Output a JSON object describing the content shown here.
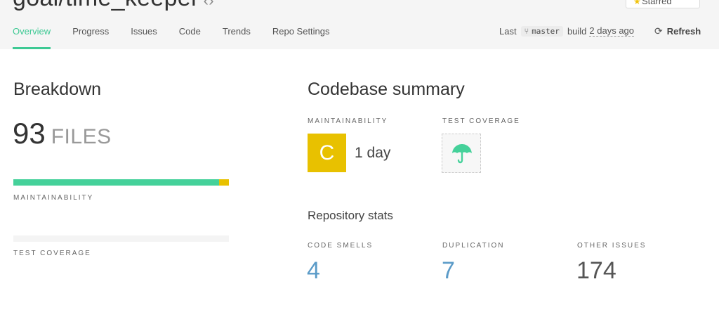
{
  "header": {
    "repo_title": "goal/time_keeper",
    "star_label": "Starred",
    "tabs": [
      {
        "label": "Overview",
        "active": true
      },
      {
        "label": "Progress"
      },
      {
        "label": "Issues"
      },
      {
        "label": "Code"
      },
      {
        "label": "Trends"
      },
      {
        "label": "Repo Settings"
      }
    ],
    "build": {
      "prefix": "Last",
      "branch": "master",
      "middle": "build",
      "ago": "2 days ago"
    },
    "refresh_label": "Refresh"
  },
  "breakdown": {
    "title": "Breakdown",
    "file_count": "93",
    "file_unit": "FILES",
    "maintainability_label": "MAINTAINABILITY",
    "maintainability_distribution": [
      {
        "grade": "A",
        "fraction": 0.955,
        "color": "#45d19a"
      },
      {
        "grade": "C",
        "fraction": 0.045,
        "color": "#e8c100"
      }
    ],
    "test_coverage_label": "TEST COVERAGE",
    "test_coverage_distribution": []
  },
  "summary": {
    "title": "Codebase summary",
    "maintainability_label": "MAINTAINABILITY",
    "maintainability_grade": "C",
    "maintainability_grade_color": "#e8c100",
    "maintainability_time": "1 day",
    "test_coverage_label": "TEST COVERAGE",
    "test_coverage_icon": "umbrella-icon",
    "test_coverage_icon_color": "#45d19a"
  },
  "stats": {
    "title": "Repository stats",
    "items": [
      {
        "label": "CODE SMELLS",
        "value": "4",
        "color": "#5b9bc8"
      },
      {
        "label": "DUPLICATION",
        "value": "7",
        "color": "#5b9bc8"
      },
      {
        "label": "OTHER ISSUES",
        "value": "174",
        "color": "#555555"
      }
    ]
  }
}
